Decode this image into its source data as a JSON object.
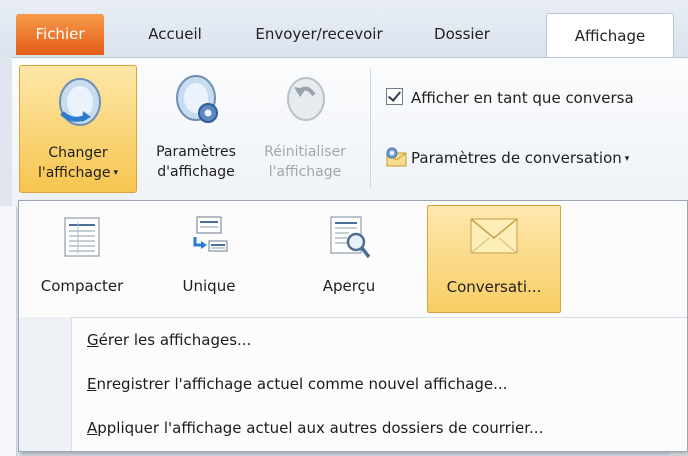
{
  "tabs": {
    "file": "Fichier",
    "home": "Accueil",
    "send_receive": "Envoyer/recevoir",
    "folder": "Dossier",
    "view": "Affichage"
  },
  "ribbon": {
    "change_view": {
      "line1": "Changer",
      "line2": "l'affichage",
      "caret": "▾"
    },
    "view_settings": {
      "line1": "Paramètres",
      "line2": "d'affichage"
    },
    "reset_view": {
      "line1": "Réinitialiser",
      "line2": "l'affichage"
    },
    "show_as_conversations": "Afficher en tant que conversa",
    "conversation_settings": "Paramètres de conversation",
    "conversation_settings_caret": "▾"
  },
  "menu": {
    "gallery": [
      {
        "label": "Compacter",
        "icon": "compact-view-icon"
      },
      {
        "label": "Unique",
        "icon": "single-view-icon"
      },
      {
        "label": "Aperçu",
        "icon": "preview-view-icon"
      },
      {
        "label": "Conversati...",
        "icon": "envelope-icon"
      }
    ],
    "manage": {
      "accel": "G",
      "rest": "érer les affichages..."
    },
    "save": {
      "accel": "E",
      "rest": "nregistrer l'affichage actuel comme nouvel affichage..."
    },
    "apply": {
      "accel": "A",
      "rest": "ppliquer l'affichage actuel aux autres dossiers de courrier..."
    }
  },
  "peek_text": "e",
  "colors": {
    "file_tab": "#e45d18",
    "selection": "#f8cd64",
    "ribbon_bg": "#f4f6f9"
  }
}
